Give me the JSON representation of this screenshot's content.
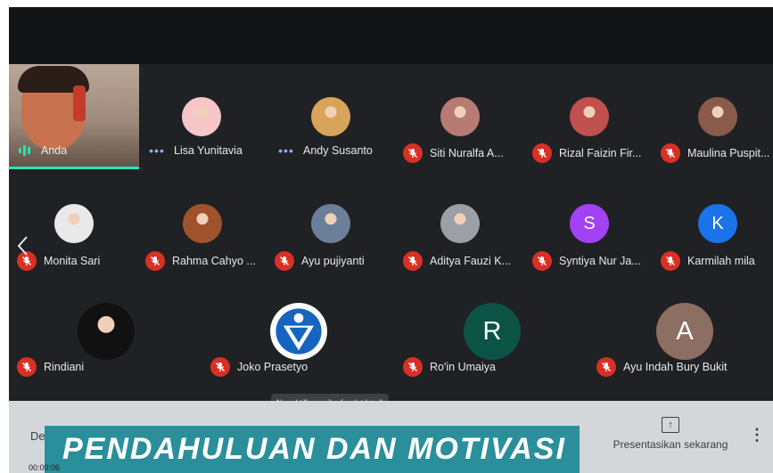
{
  "self": {
    "name": "Anda"
  },
  "participants_row1": [
    {
      "name": "Lisa Yunitavia",
      "status": "speaking",
      "avatar": "photo",
      "avatar_color": "#f6c6c8"
    },
    {
      "name": "Andy Susanto",
      "status": "speaking",
      "avatar": "photo",
      "avatar_color": "#d8a45a"
    },
    {
      "name": "Siti Nuralfa A...",
      "status": "muted",
      "avatar": "photo",
      "avatar_color": "#b77b73"
    },
    {
      "name": "Rizal Faizin Fir...",
      "status": "muted",
      "avatar": "photo",
      "avatar_color": "#c0504d"
    },
    {
      "name": "Maulina Puspit...",
      "status": "muted",
      "avatar": "photo",
      "avatar_color": "#8a5a4a"
    }
  ],
  "participants_row2": [
    {
      "name": "Monita Sari",
      "status": "muted",
      "avatar": "photo",
      "avatar_color": "#e9e9e9"
    },
    {
      "name": "Rahma Cahyo ...",
      "status": "muted",
      "avatar": "photo",
      "avatar_color": "#a0522d"
    },
    {
      "name": "Ayu pujiyanti",
      "status": "muted",
      "avatar": "photo",
      "avatar_color": "#6b7f9a"
    },
    {
      "name": "Aditya Fauzi K...",
      "status": "muted",
      "avatar": "photo",
      "avatar_color": "#9aa0a6"
    },
    {
      "name": "Syntiya Nur Ja...",
      "status": "muted",
      "avatar": "letter",
      "letter": "S",
      "avatar_color": "#a142f4"
    },
    {
      "name": "Karmilah mila",
      "status": "muted",
      "avatar": "letter",
      "letter": "K",
      "avatar_color": "#1a73e8"
    }
  ],
  "participants_row3": [
    {
      "name": "Rindiani",
      "status": "muted",
      "avatar": "photo",
      "avatar_color": "#111111"
    },
    {
      "name": "Joko Prasetyo",
      "status": "muted",
      "avatar": "logo",
      "avatar_color": "#ffffff"
    },
    {
      "name": "Ro'in Umaiya",
      "status": "muted",
      "avatar": "letter",
      "letter": "R",
      "avatar_color": "#0b5345"
    },
    {
      "name": "Ayu Indah Bury Bukit",
      "status": "muted",
      "avatar": "letter",
      "letter": "A",
      "avatar_color": "#8d6e63"
    }
  ],
  "tooltip": "Nonaktifkan mikrofon (ctrl + d)",
  "banner_text": "PENDAHULUAN DAN MOTIVASI",
  "bottom_left_text": "De",
  "timer": "00:00:06",
  "present_button": {
    "label": "Presentasikan sekarang",
    "icon": "present-upload-icon"
  },
  "more_icon": "more-vert-icon",
  "colors": {
    "muted_badge": "#d93025",
    "speaking": "#8ab4f8",
    "self_underline": "#1de9b6",
    "banner": "#2a8f9a"
  }
}
